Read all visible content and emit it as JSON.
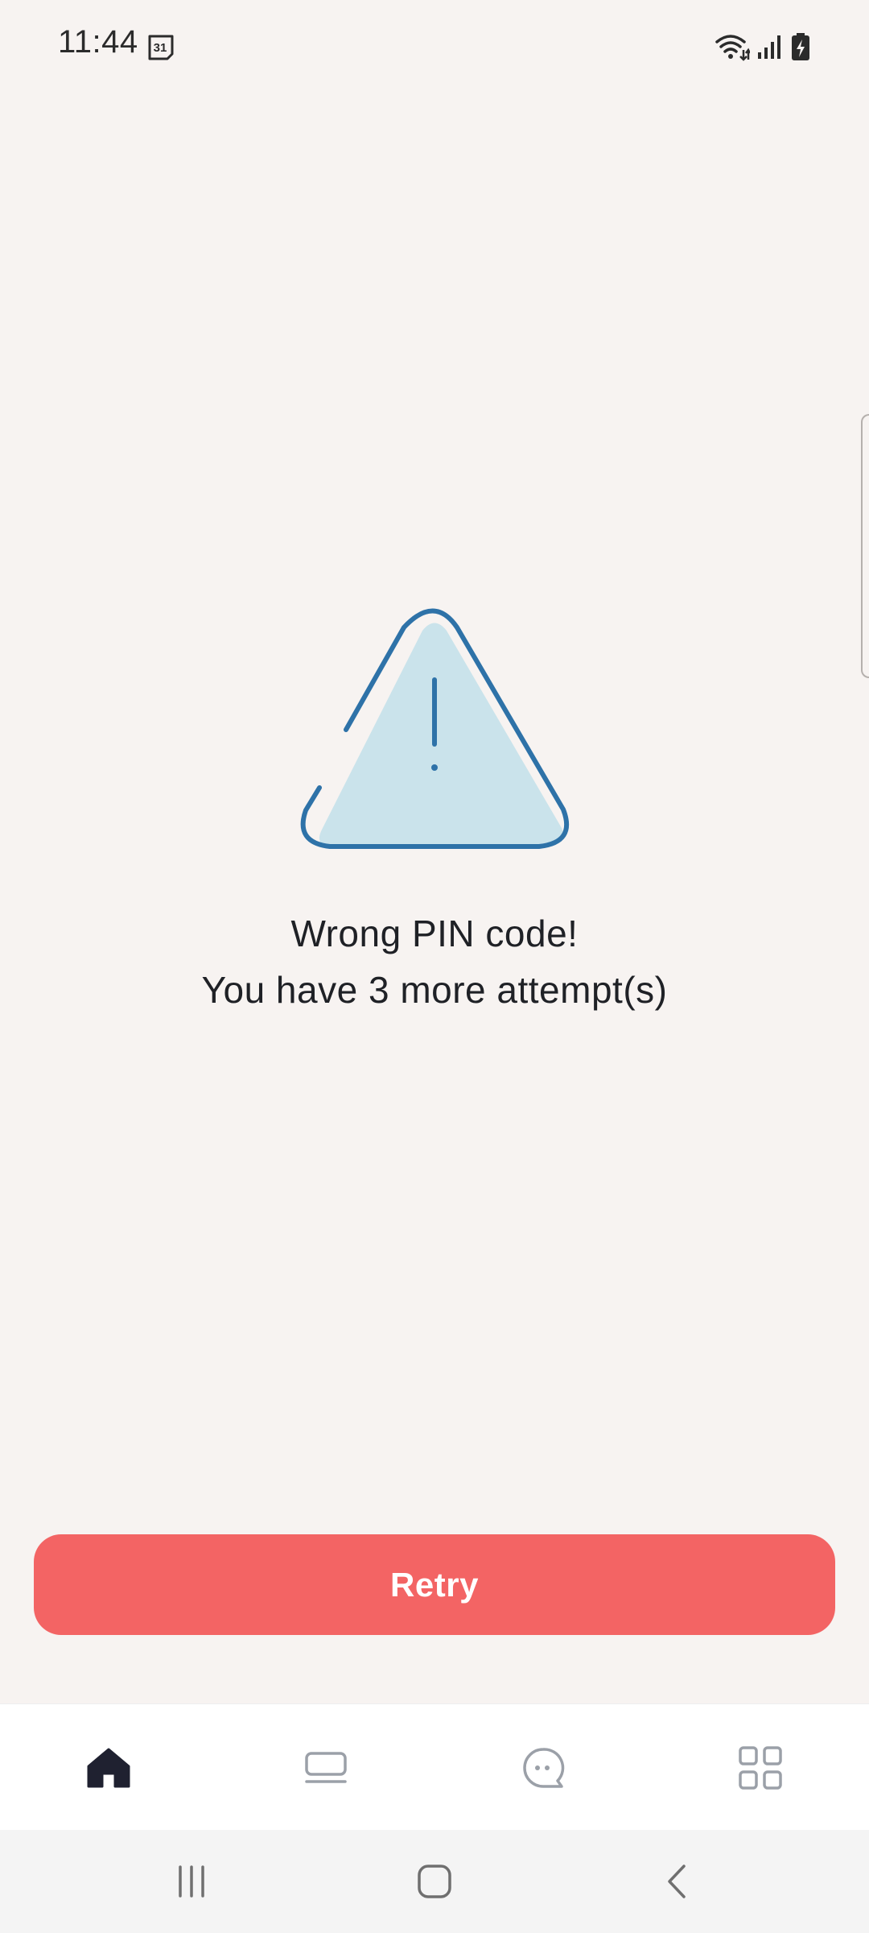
{
  "status_bar": {
    "time": "11:44",
    "calendar_day": "31",
    "icons": [
      "calendar-icon",
      "wifi-icon",
      "signal-icon",
      "battery-charging-icon"
    ]
  },
  "error": {
    "illustration": "warning-triangle-icon",
    "title": "Wrong PIN code!",
    "subtitle": "You have 3 more attempt(s)"
  },
  "retry_button": {
    "label": "Retry"
  },
  "bottom_nav": {
    "items": [
      {
        "icon": "home-icon",
        "active": true
      },
      {
        "icon": "card-icon",
        "active": false
      },
      {
        "icon": "chat-icon",
        "active": false
      },
      {
        "icon": "grid-icon",
        "active": false
      }
    ]
  },
  "system_nav": {
    "items": [
      "recents-icon",
      "home-button-icon",
      "back-icon"
    ]
  },
  "colors": {
    "background": "#f7f3f1",
    "accent": "#f36464",
    "illustration_stroke": "#2e72a8",
    "illustration_fill": "#cae3eb",
    "text": "#1f2126"
  }
}
